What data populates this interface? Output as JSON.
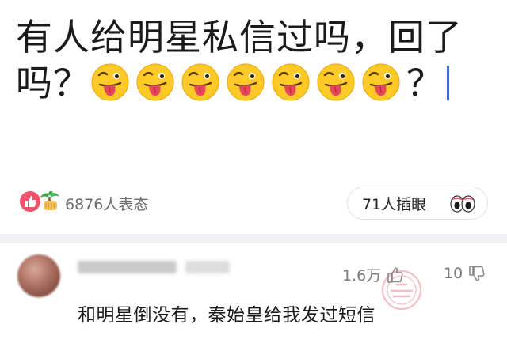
{
  "post": {
    "title_line1": "有人给明星私信过吗，回了",
    "title_line2_prefix": "吗？",
    "title_line2_suffix": "？",
    "emoji_count": 7,
    "emoji_icon": "tongue-out-wink-face-icon"
  },
  "reactions": {
    "count_text": "6876人表态",
    "icons": [
      "thumbs-up-icon",
      "palm-tree-fist-icon"
    ],
    "thumb_color": "#f4516c"
  },
  "peek": {
    "label": "71人插眼",
    "icon": "eyes-icon"
  },
  "comment": {
    "like_count": "1.6万",
    "dislike_count": "10",
    "text": "和明星倒没有，秦始皇给我发过短信",
    "watermark_icon": "seal-watermark-icon"
  },
  "colors": {
    "caret": "#3b6fd8",
    "divider": "#f1f1f3",
    "emoji_face": "#ffc928",
    "tongue": "#e8455a"
  }
}
